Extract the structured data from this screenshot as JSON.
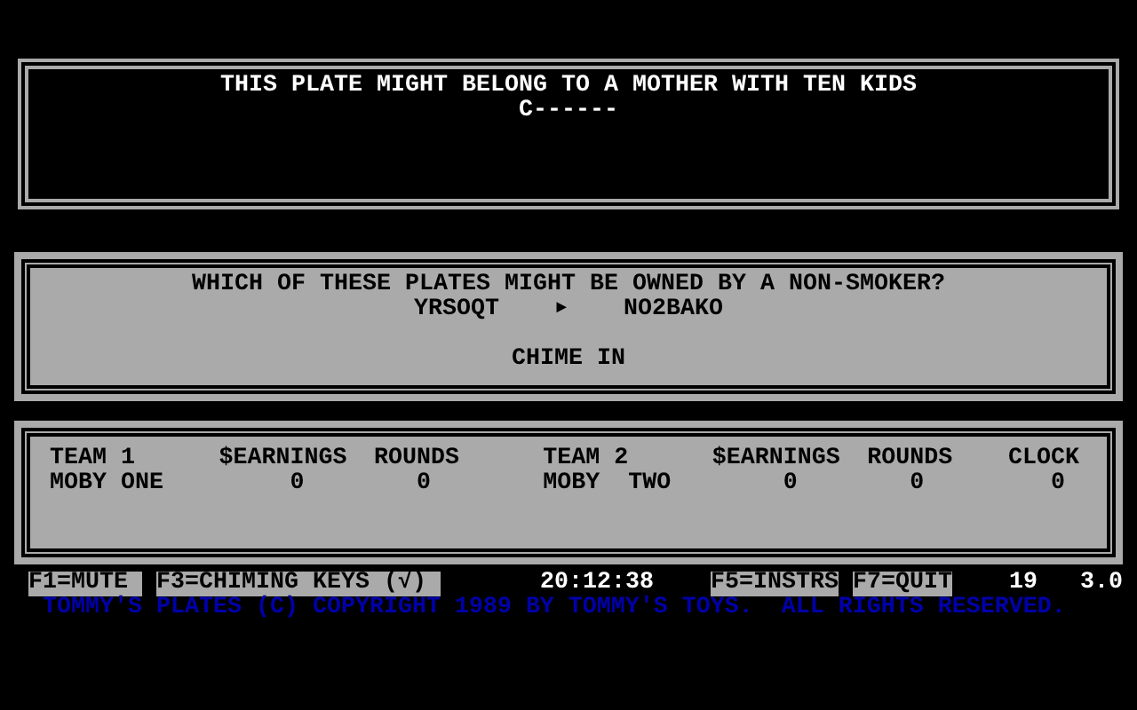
{
  "clue_panel": {
    "clue": "THIS PLATE MIGHT BELONG TO A MOTHER WITH TEN KIDS",
    "answer": "C------"
  },
  "question_panel": {
    "question": "WHICH OF THESE PLATES MIGHT BE OWNED BY A NON-SMOKER?",
    "plates": [
      "YRSOQT",
      "NO2BAKO"
    ],
    "arrow": "►",
    "prompt": "CHIME IN"
  },
  "scoreboard": {
    "columns": [
      "TEAM 1",
      "$EARNINGS",
      "ROUNDS",
      "TEAM 2",
      "$EARNINGS",
      "ROUNDS",
      "CLOCK"
    ],
    "values": [
      "MOBY ONE",
      "0",
      "0",
      "MOBY  TWO",
      "0",
      "0",
      "0"
    ]
  },
  "status_bar": {
    "keys": [
      {
        "label": "F1=MUTE"
      },
      {
        "label": "F3=CHIMING KEYS (√)"
      }
    ],
    "time": "20:12:38",
    "keys_right": [
      {
        "label": "F5=INSTRS"
      },
      {
        "label": "F7=QUIT"
      }
    ],
    "number": "19",
    "version": "3.0"
  },
  "copyright": "TOMMY'S PLATES (C) COPYRIGHT 1989 BY TOMMY'S TOYS.  ALL RIGHTS RESERVED."
}
